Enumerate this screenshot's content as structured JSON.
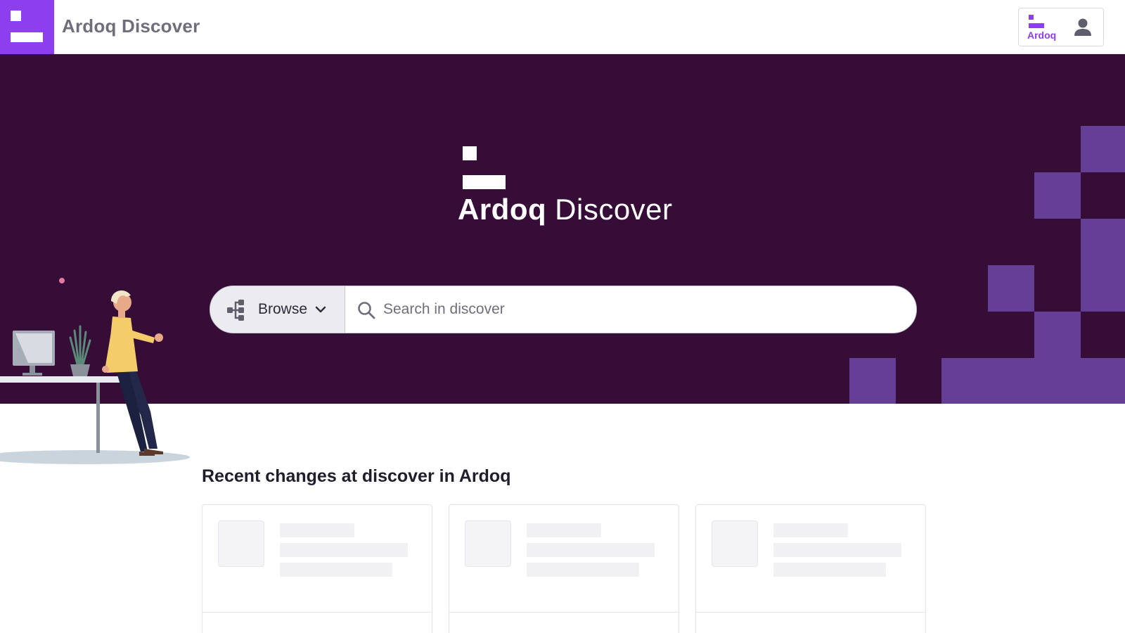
{
  "app": {
    "title": "Ardoq Discover",
    "brand_color": "#8d3ff0"
  },
  "header": {
    "ardoq_switch_label": "Ardoq",
    "user_icon": "user-icon"
  },
  "hero": {
    "brand_bold": "Ardoq",
    "brand_light": "Discover",
    "background_color": "#360d37",
    "accent_color": "#653e96"
  },
  "search": {
    "browse_label": "Browse",
    "browse_icon": "hierarchy-icon",
    "placeholder": "Search in discover",
    "value": ""
  },
  "recent": {
    "title": "Recent changes at discover in Ardoq",
    "cards": [
      {
        "state": "loading"
      },
      {
        "state": "loading"
      },
      {
        "state": "loading"
      }
    ]
  }
}
